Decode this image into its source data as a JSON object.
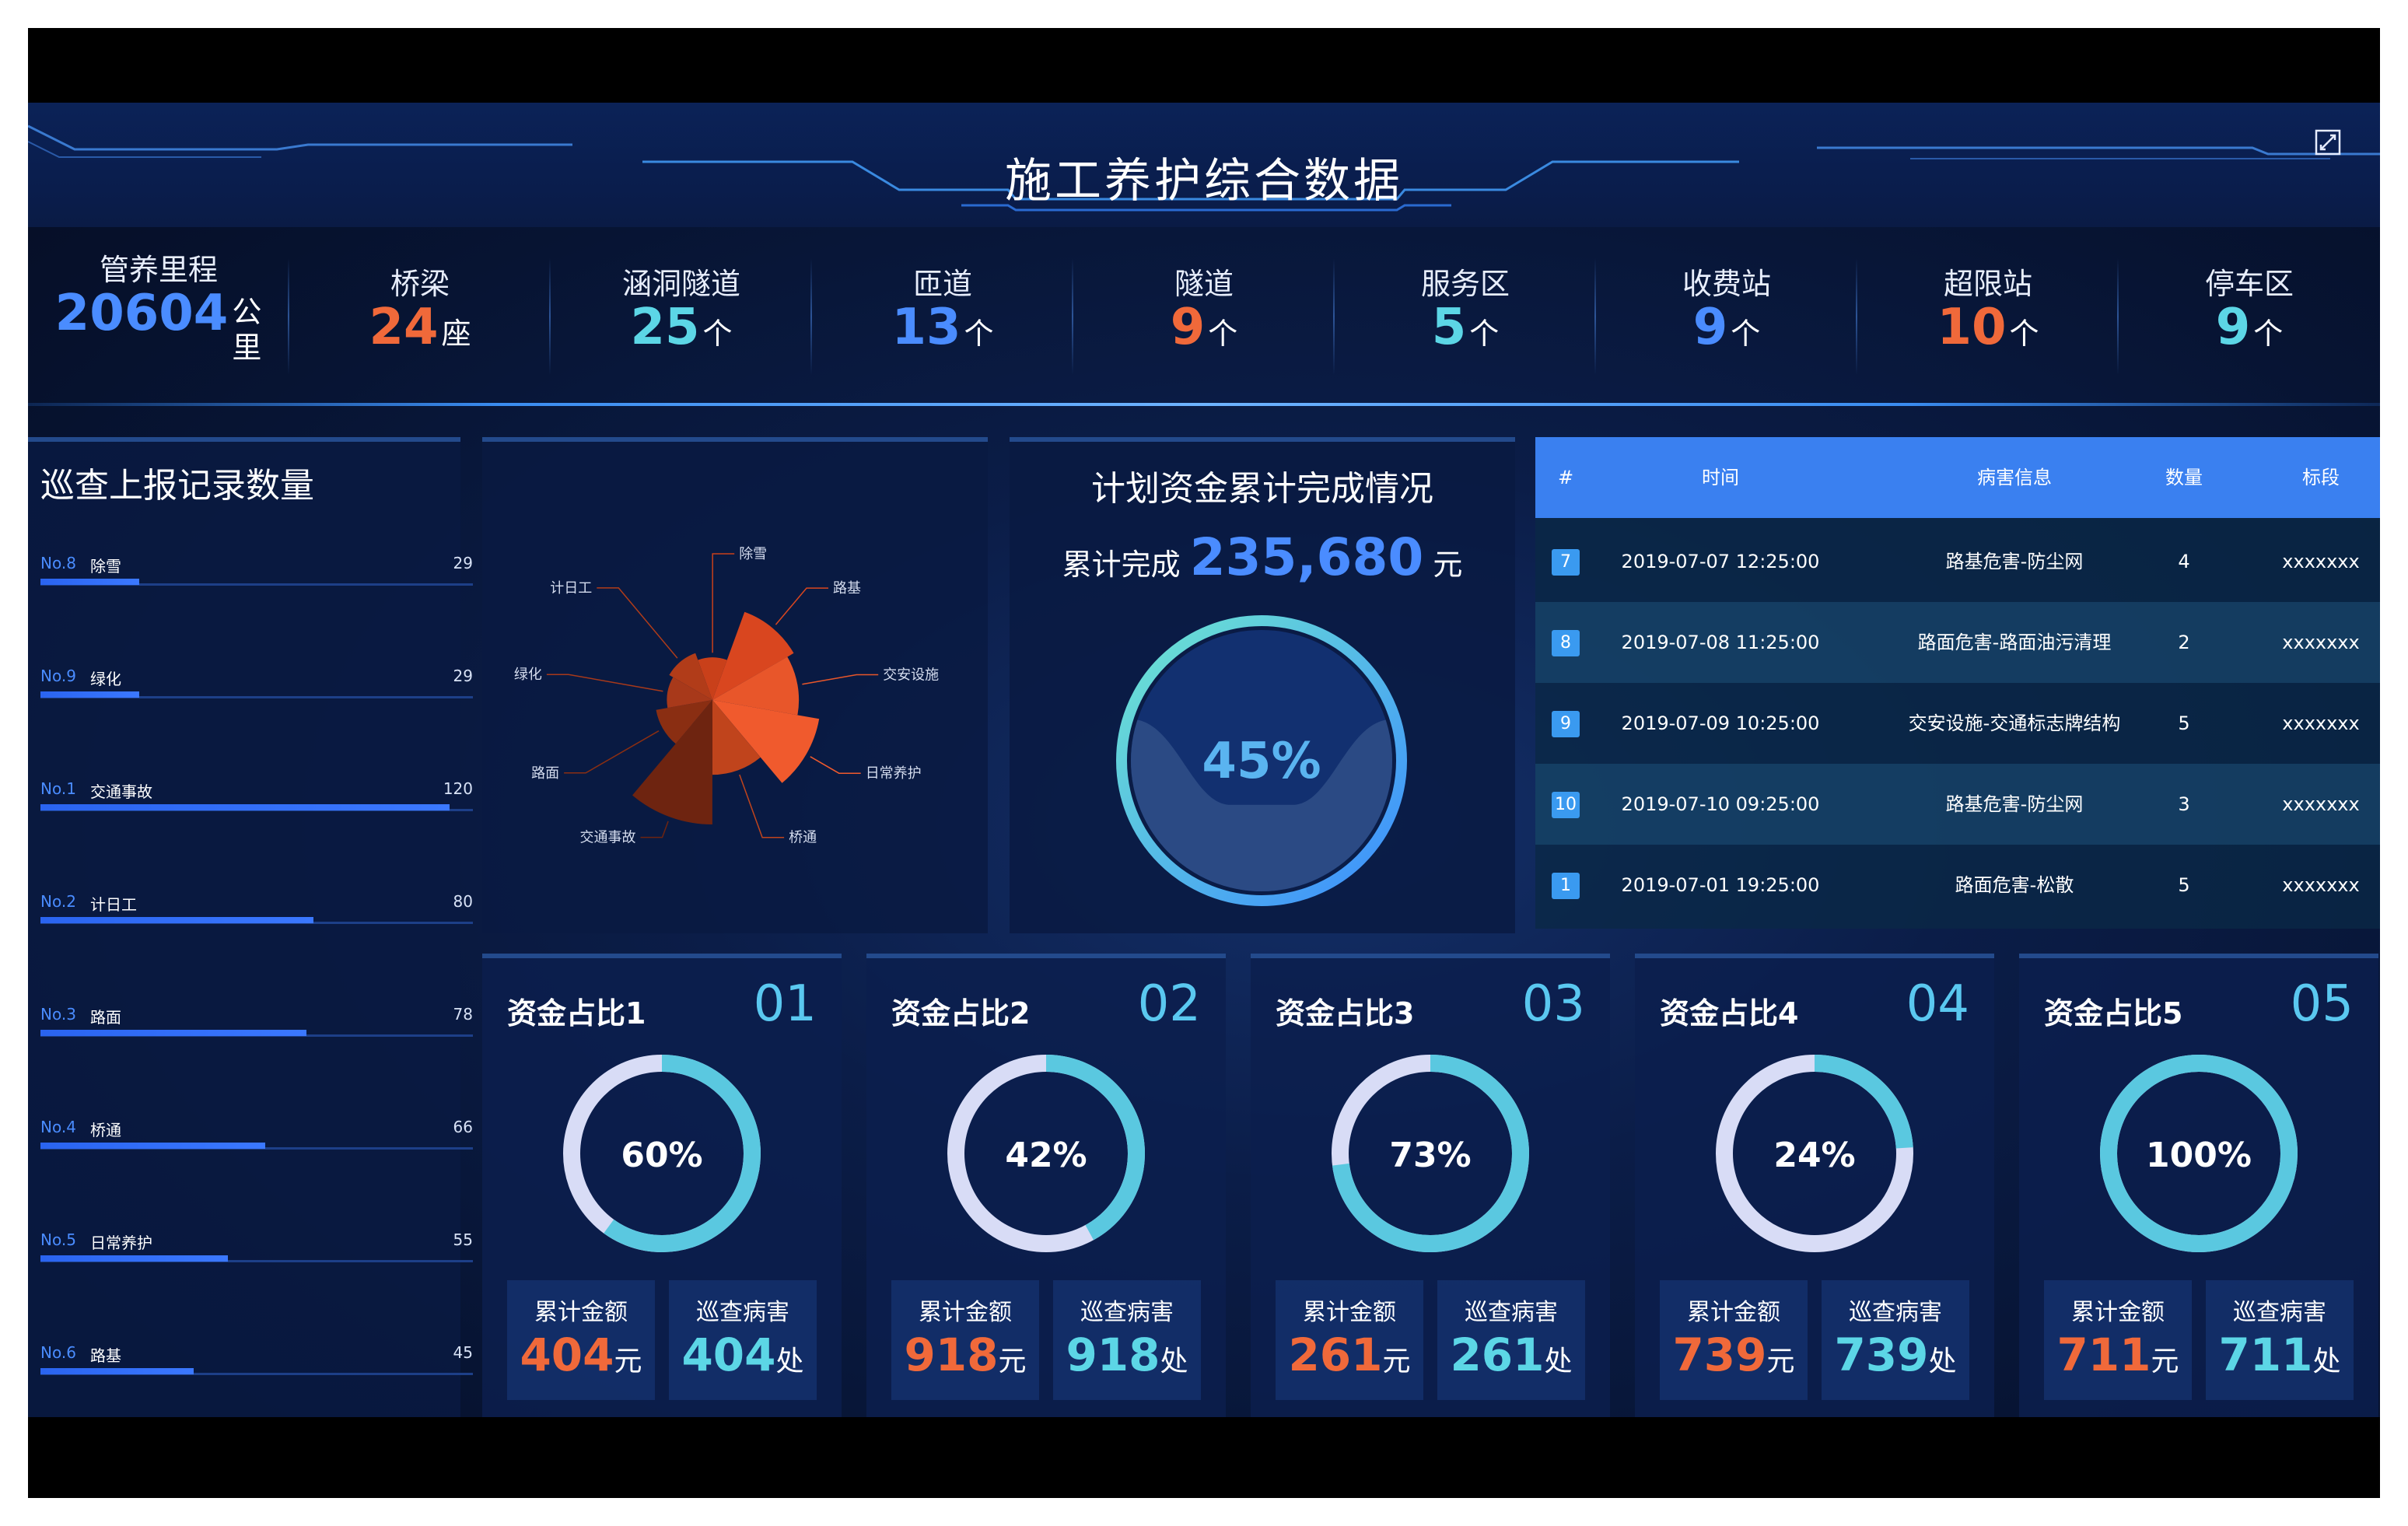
{
  "header": {
    "title": "施工养护综合数据"
  },
  "stats": [
    {
      "label": "管养里程",
      "value": "20604",
      "unit": "公里",
      "color": "#4a8cff"
    },
    {
      "label": "桥梁",
      "value": "24",
      "unit": "座",
      "color": "#f0693a"
    },
    {
      "label": "涵洞隧道",
      "value": "25",
      "unit": "个",
      "color": "#5cd6e6"
    },
    {
      "label": "匝道",
      "value": "13",
      "unit": "个",
      "color": "#4a8cff"
    },
    {
      "label": "隧道",
      "value": "9",
      "unit": "个",
      "color": "#f0693a"
    },
    {
      "label": "服务区",
      "value": "5",
      "unit": "个",
      "color": "#5cd6e6"
    },
    {
      "label": "收费站",
      "value": "9",
      "unit": "个",
      "color": "#4a8cff"
    },
    {
      "label": "超限站",
      "value": "10",
      "unit": "个",
      "color": "#f0693a"
    },
    {
      "label": "停车区",
      "value": "9",
      "unit": "个",
      "color": "#5cd6e6"
    }
  ],
  "patrol": {
    "title": "巡查上报记录数量",
    "items": [
      {
        "no": "No.8",
        "name": "除雪",
        "value": "29"
      },
      {
        "no": "No.9",
        "name": "绿化",
        "value": "29"
      },
      {
        "no": "No.1",
        "name": "交通事故",
        "value": "120"
      },
      {
        "no": "No.2",
        "name": "计日工",
        "value": "80"
      },
      {
        "no": "No.3",
        "name": "路面",
        "value": "78"
      },
      {
        "no": "No.4",
        "name": "桥通",
        "value": "66"
      },
      {
        "no": "No.5",
        "name": "日常养护",
        "value": "55"
      },
      {
        "no": "No.6",
        "name": "路基",
        "value": "45"
      }
    ]
  },
  "chart_data": {
    "type": "pie",
    "subtype": "rose",
    "categories": [
      "路基",
      "交安设施",
      "日常养护",
      "桥通",
      "交通事故",
      "路面",
      "绿化",
      "计日工",
      "除雪"
    ],
    "values": [
      45,
      40,
      55,
      32,
      66,
      20,
      12,
      15,
      10
    ],
    "colors": [
      "#d9461f",
      "#e8562a",
      "#f05a2d",
      "#c0441c",
      "#6e2410",
      "#8a2e12",
      "#a8391a",
      "#b13c19",
      "#c9401a"
    ]
  },
  "funding": {
    "title": "计划资金累计完成情况",
    "label": "累计完成",
    "amount": "235,680",
    "unit": "元",
    "percent": "45%",
    "percent_value": 0.45
  },
  "damage_table": {
    "headers": [
      "#",
      "时间",
      "病害信息",
      "数量",
      "标段"
    ],
    "rows": [
      {
        "idx": "7",
        "time": "2019-07-07 12:25:00",
        "info": "路基危害-防尘网",
        "count": "4",
        "section": "xxxxxxx"
      },
      {
        "idx": "8",
        "time": "2019-07-08 11:25:00",
        "info": "路面危害-路面油污清理",
        "count": "2",
        "section": "xxxxxxx"
      },
      {
        "idx": "9",
        "time": "2019-07-09 10:25:00",
        "info": "交安设施-交通标志牌结构",
        "count": "5",
        "section": "xxxxxxx"
      },
      {
        "idx": "10",
        "time": "2019-07-10 09:25:00",
        "info": "路基危害-防尘网",
        "count": "3",
        "section": "xxxxxxx"
      },
      {
        "idx": "1",
        "time": "2019-07-01 19:25:00",
        "info": "路面危害-松散",
        "count": "5",
        "section": "xxxxxxx"
      }
    ]
  },
  "fund_cards": [
    {
      "title": "资金占比1",
      "num": "01",
      "percent": "60%",
      "pv": 0.6,
      "amount_label": "累计金额",
      "amount": "404",
      "amount_unit": "元",
      "damage_label": "巡查病害",
      "damage": "404",
      "damage_unit": "处"
    },
    {
      "title": "资金占比2",
      "num": "02",
      "percent": "42%",
      "pv": 0.42,
      "amount_label": "累计金额",
      "amount": "918",
      "amount_unit": "元",
      "damage_label": "巡查病害",
      "damage": "918",
      "damage_unit": "处"
    },
    {
      "title": "资金占比3",
      "num": "03",
      "percent": "73%",
      "pv": 0.73,
      "amount_label": "累计金额",
      "amount": "261",
      "amount_unit": "元",
      "damage_label": "巡查病害",
      "damage": "261",
      "damage_unit": "处"
    },
    {
      "title": "资金占比4",
      "num": "04",
      "percent": "24%",
      "pv": 0.24,
      "amount_label": "累计金额",
      "amount": "739",
      "amount_unit": "元",
      "damage_label": "巡查病害",
      "damage": "739",
      "damage_unit": "处"
    },
    {
      "title": "资金占比5",
      "num": "05",
      "percent": "100%",
      "pv": 1.0,
      "amount_label": "累计金额",
      "amount": "711",
      "amount_unit": "元",
      "damage_label": "巡查病害",
      "damage": "711",
      "damage_unit": "处"
    }
  ],
  "colors": {
    "accent_blue": "#4a8cff",
    "accent_orange": "#f0693a",
    "accent_cyan": "#5cd6e6",
    "ring_track": "#d8dcf6",
    "ring_fill": "#5ac8e0"
  }
}
